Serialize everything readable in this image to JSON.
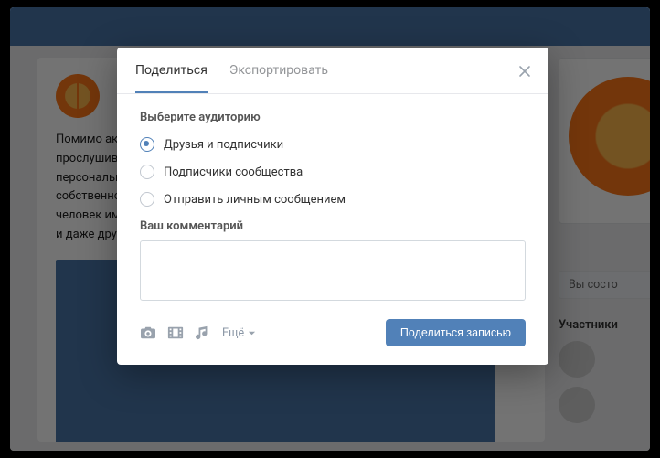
{
  "background": {
    "post_text": "Помимо акт\nпрослушив\nперсональн\nсобственно\nчеловек им\nи даже дру",
    "side_status": "Вы состо",
    "participants_label": "Участники"
  },
  "modal": {
    "tabs": {
      "share": "Поделиться",
      "export": "Экспортировать"
    },
    "section_title": "Выберите аудиторию",
    "options": {
      "friends": "Друзья и подписчики",
      "community": "Подписчики сообщества",
      "private": "Отправить личным сообщением"
    },
    "comment_label": "Ваш комментарий",
    "comment_value": "",
    "attach_more": "Ещё",
    "submit": "Поделиться записью"
  }
}
